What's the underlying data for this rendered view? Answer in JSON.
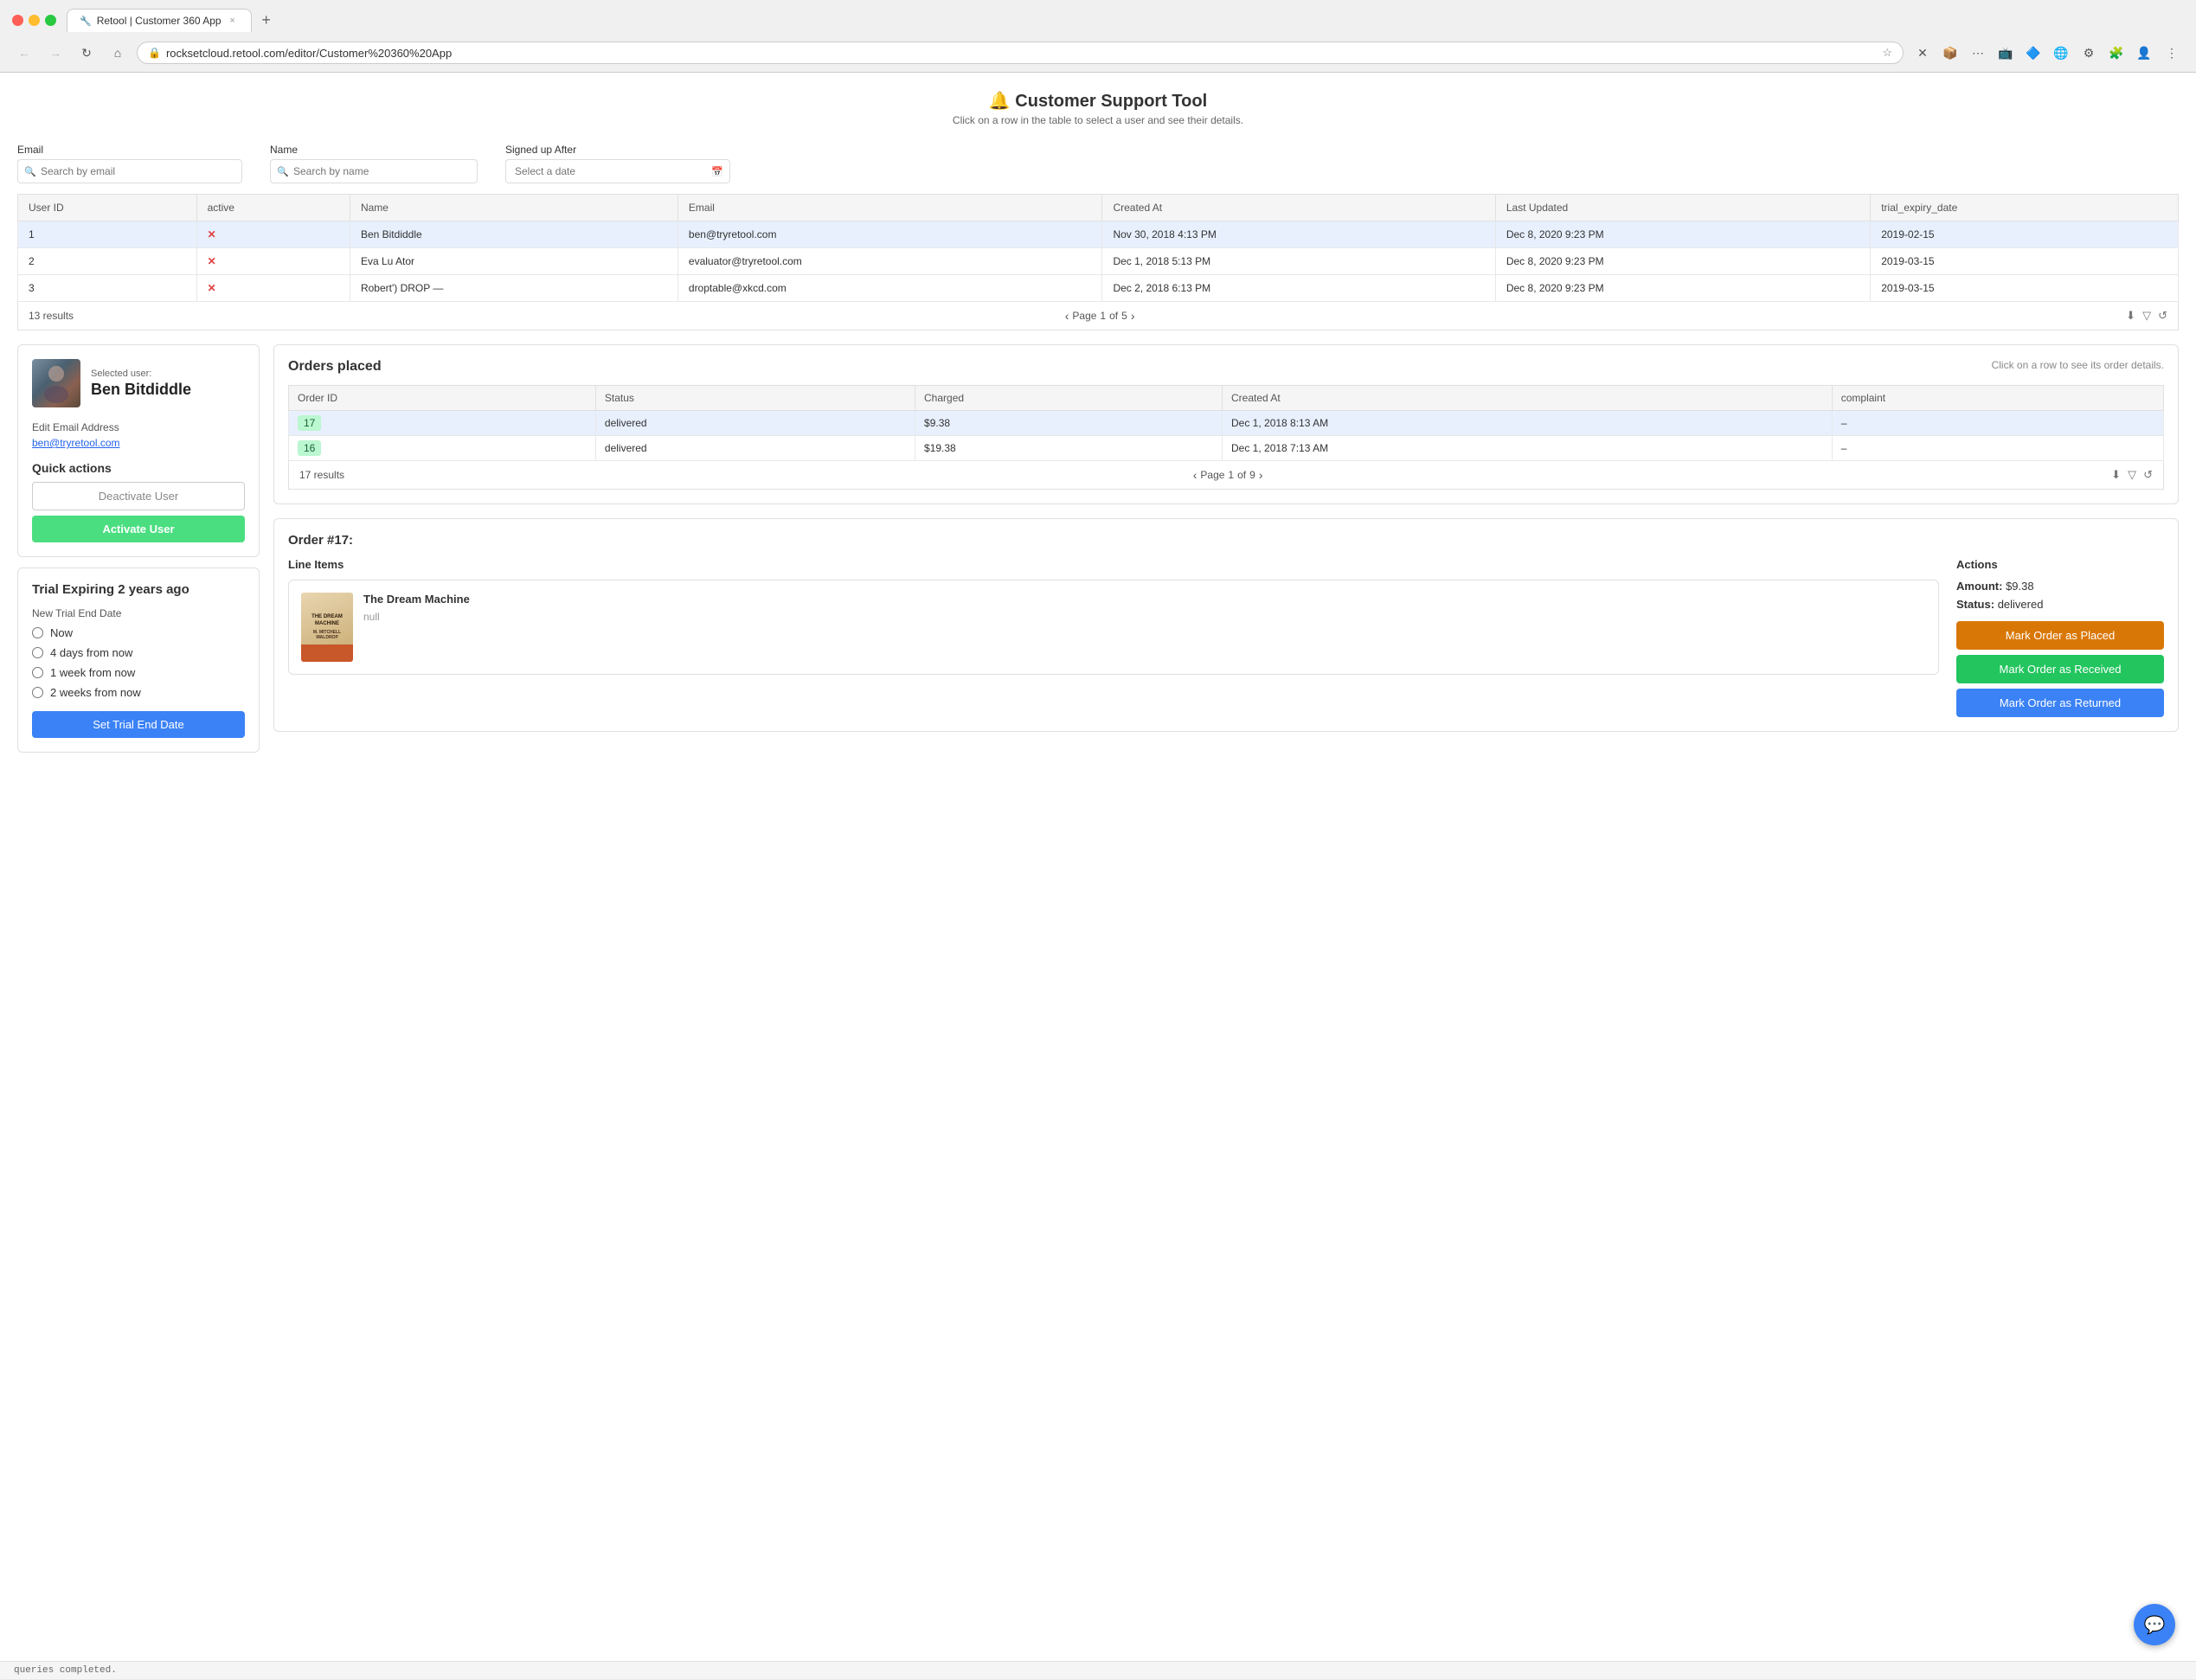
{
  "browser": {
    "tab_title": "Retool | Customer 360 App",
    "tab_icon": "🔧",
    "close_label": "×",
    "new_tab_label": "+",
    "url": "rocksetcloud.retool.com/editor/Customer%20360%20App",
    "back_label": "←",
    "forward_label": "→",
    "reload_label": "↻",
    "home_label": "⌂"
  },
  "page": {
    "title": "🔔 Customer Support Tool",
    "subtitle": "Click on a row in the table to select a user and see their details."
  },
  "search": {
    "email_label": "Email",
    "email_placeholder": "Search by email",
    "name_label": "Name",
    "name_placeholder": "Search by name",
    "date_label": "Signed up After",
    "date_placeholder": "Select a date"
  },
  "users_table": {
    "columns": [
      "User ID",
      "active",
      "Name",
      "Email",
      "Created At",
      "Last Updated",
      "trial_expiry_date"
    ],
    "rows": [
      {
        "id": 1,
        "active": "✕",
        "name": "Ben Bitdiddle",
        "email": "ben@tryretool.com",
        "created_at": "Nov 30, 2018 4:13 PM",
        "last_updated": "Dec 8, 2020 9:23 PM",
        "trial_expiry": "2019-02-15"
      },
      {
        "id": 2,
        "active": "✕",
        "name": "Eva Lu Ator",
        "email": "evaluator@tryretool.com",
        "created_at": "Dec 1, 2018 5:13 PM",
        "last_updated": "Dec 8, 2020 9:23 PM",
        "trial_expiry": "2019-03-15"
      },
      {
        "id": 3,
        "active": "✕",
        "name": "Robert') DROP —",
        "email": "droptable@xkcd.com",
        "created_at": "Dec 2, 2018 6:13 PM",
        "last_updated": "Dec 8, 2020 9:23 PM",
        "trial_expiry": "2019-03-15"
      }
    ],
    "results_label": "13 results",
    "page_label": "Page",
    "current_page": "1",
    "total_pages": "5",
    "of_label": "of"
  },
  "user_card": {
    "selected_label": "Selected user:",
    "name": "Ben Bitdiddle",
    "edit_email_label": "Edit Email Address",
    "email": "ben@tryretool.com",
    "quick_actions_label": "Quick actions",
    "deactivate_label": "Deactivate User",
    "activate_label": "Activate User"
  },
  "trial_card": {
    "title": "Trial Expiring 2 years ago",
    "date_label": "New Trial End Date",
    "options": [
      "Now",
      "4 days from now",
      "1 week from now",
      "2 weeks from now"
    ],
    "set_button_label": "Set Trial End Date"
  },
  "orders": {
    "title": "Orders placed",
    "hint": "Click on a row to see its order details.",
    "columns": [
      "Order ID",
      "Status",
      "Charged",
      "Created At",
      "complaint"
    ],
    "rows": [
      {
        "id": 17,
        "status": "delivered",
        "charged": "$9.38",
        "created_at": "Dec 1, 2018 8:13 AM",
        "complaint": "–"
      },
      {
        "id": 16,
        "status": "delivered",
        "charged": "$19.38",
        "created_at": "Dec 1, 2018 7:13 AM",
        "complaint": "–"
      }
    ],
    "results_label": "17 results",
    "page_label": "Page",
    "current_page": "1",
    "total_pages": "9",
    "of_label": "of"
  },
  "order_detail": {
    "title": "Order #17:",
    "line_items_label": "Line Items",
    "item_name": "The Dream Machine",
    "item_null": "null",
    "actions_label": "Actions",
    "amount_label": "Amount:",
    "amount_value": "$9.38",
    "status_label": "Status:",
    "status_value": "delivered",
    "btn_placed": "Mark Order as Placed",
    "btn_received": "Mark Order as Received",
    "btn_returned": "Mark Order as Returned"
  },
  "status_bar": {
    "text": "queries completed."
  }
}
